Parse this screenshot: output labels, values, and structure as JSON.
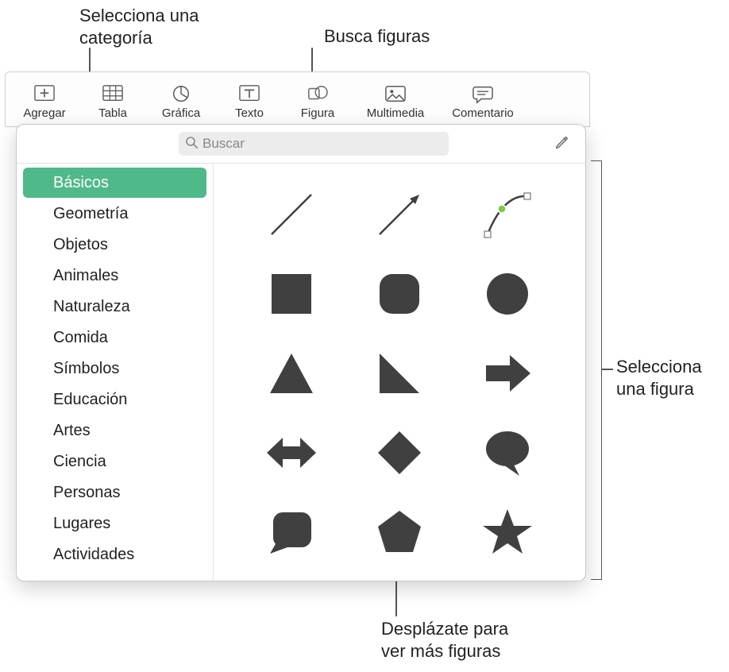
{
  "callouts": {
    "category": "Selecciona una\ncategoría",
    "search": "Busca figuras",
    "select_shape": "Selecciona\nuna figura",
    "scroll": "Desplázate para\nver más figuras"
  },
  "toolbar": {
    "items": [
      {
        "label": "Agregar",
        "icon": "plus"
      },
      {
        "label": "Tabla",
        "icon": "table"
      },
      {
        "label": "Gráfica",
        "icon": "chart"
      },
      {
        "label": "Texto",
        "icon": "text"
      },
      {
        "label": "Figura",
        "icon": "shape",
        "active": true
      },
      {
        "label": "Multimedia",
        "icon": "media"
      },
      {
        "label": "Comentario",
        "icon": "comment"
      }
    ]
  },
  "search": {
    "placeholder": "Buscar"
  },
  "sidebar": {
    "items": [
      {
        "label": "Básicos",
        "selected": true
      },
      {
        "label": "Geometría"
      },
      {
        "label": "Objetos"
      },
      {
        "label": "Animales"
      },
      {
        "label": "Naturaleza"
      },
      {
        "label": "Comida"
      },
      {
        "label": "Símbolos"
      },
      {
        "label": "Educación"
      },
      {
        "label": "Artes"
      },
      {
        "label": "Ciencia"
      },
      {
        "label": "Personas"
      },
      {
        "label": "Lugares"
      },
      {
        "label": "Actividades"
      }
    ]
  },
  "shapes": [
    "line",
    "arrow-line",
    "bezier",
    "square",
    "rounded-square",
    "circle",
    "triangle",
    "right-triangle",
    "arrow-right",
    "arrow-both",
    "diamond",
    "speech-bubble",
    "rounded-callout",
    "pentagon",
    "star"
  ]
}
